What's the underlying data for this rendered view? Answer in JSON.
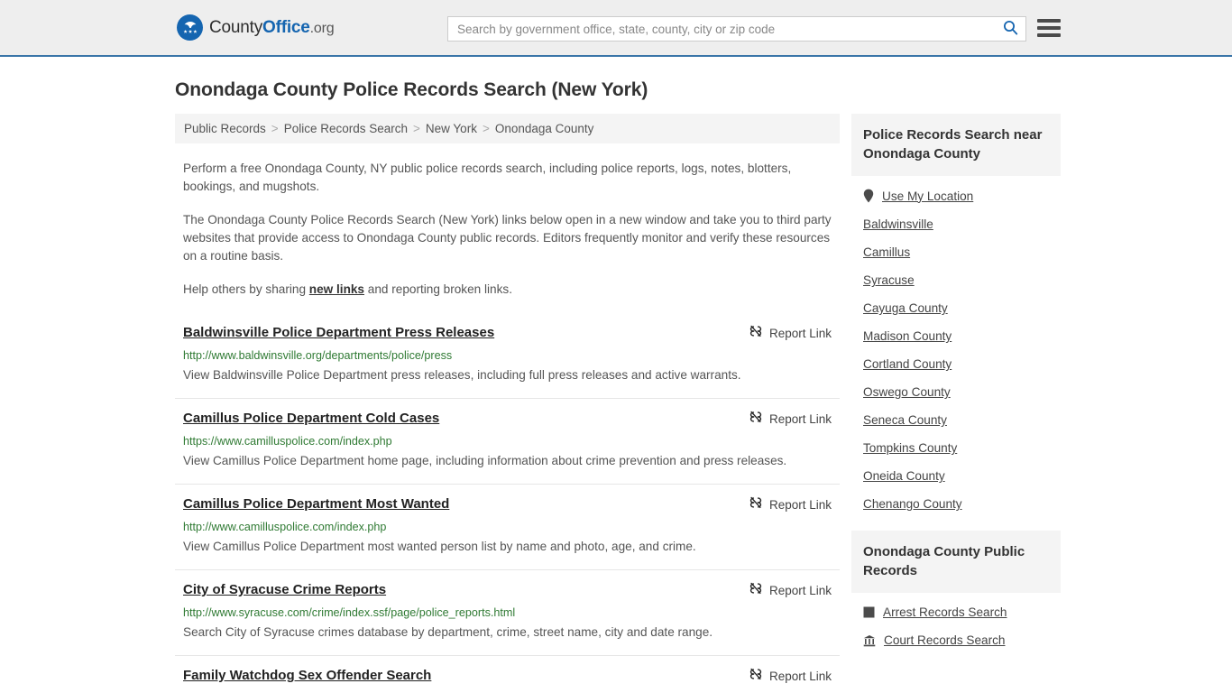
{
  "header": {
    "brand": {
      "part1": "County",
      "part2": "Office",
      "part3": ".org",
      "logo_icon": "eagle-shield-logo"
    },
    "search": {
      "placeholder": "Search by government office, state, county, city or zip code",
      "value": "",
      "search_icon": "search-icon"
    },
    "menu_icon": "hamburger-menu-icon",
    "accent_color": "#3a75a8",
    "background_color": "#eeeeee"
  },
  "page": {
    "title": "Onondaga County Police Records Search (New York)"
  },
  "breadcrumb": {
    "items": [
      "Public Records",
      "Police Records Search",
      "New York",
      "Onondaga County"
    ],
    "separator": ">"
  },
  "intro": {
    "p1": "Perform a free Onondaga County, NY public police records search, including police reports, logs, notes, blotters, bookings, and mugshots.",
    "p2": "The Onondaga County Police Records Search (New York) links below open in a new window and take you to third party websites that provide access to Onondaga County public records. Editors frequently monitor and verify these resources on a routine basis.",
    "p3_before": "Help others by sharing ",
    "p3_link": "new links",
    "p3_after": " and reporting broken links."
  },
  "results": {
    "report_label": "Report Link",
    "report_icon": "broken-link-icon",
    "url_color": "#2f7a33",
    "items": [
      {
        "title": "Baldwinsville Police Department Press Releases",
        "url": "http://www.baldwinsville.org/departments/police/press",
        "description": "View Baldwinsville Police Department press releases, including full press releases and active warrants."
      },
      {
        "title": "Camillus Police Department Cold Cases",
        "url": "https://www.camilluspolice.com/index.php",
        "description": "View Camillus Police Department home page, including information about crime prevention and press releases."
      },
      {
        "title": "Camillus Police Department Most Wanted",
        "url": "http://www.camilluspolice.com/index.php",
        "description": "View Camillus Police Department most wanted person list by name and photo, age, and crime."
      },
      {
        "title": "City of Syracuse Crime Reports",
        "url": "http://www.syracuse.com/crime/index.ssf/page/police_reports.html",
        "description": "Search City of Syracuse crimes database by department, crime, street name, city and date range."
      },
      {
        "title": "Family Watchdog Sex Offender Search",
        "url": "",
        "description": ""
      }
    ]
  },
  "sidebar": {
    "nearby": {
      "heading": "Police Records Search near Onondaga County",
      "items": [
        {
          "label": "Use My Location",
          "icon": "map-pin-icon"
        },
        {
          "label": "Baldwinsville",
          "icon": ""
        },
        {
          "label": "Camillus",
          "icon": ""
        },
        {
          "label": "Syracuse",
          "icon": ""
        },
        {
          "label": "Cayuga County",
          "icon": ""
        },
        {
          "label": "Madison County",
          "icon": ""
        },
        {
          "label": "Cortland County",
          "icon": ""
        },
        {
          "label": "Oswego County",
          "icon": ""
        },
        {
          "label": "Seneca County",
          "icon": ""
        },
        {
          "label": "Tompkins County",
          "icon": ""
        },
        {
          "label": "Oneida County",
          "icon": ""
        },
        {
          "label": "Chenango County",
          "icon": ""
        }
      ]
    },
    "public_records": {
      "heading": "Onondaga County Public Records",
      "items": [
        {
          "label": "Arrest Records Search",
          "icon": "square-icon"
        },
        {
          "label": "Court Records Search",
          "icon": "courthouse-icon"
        }
      ]
    }
  }
}
